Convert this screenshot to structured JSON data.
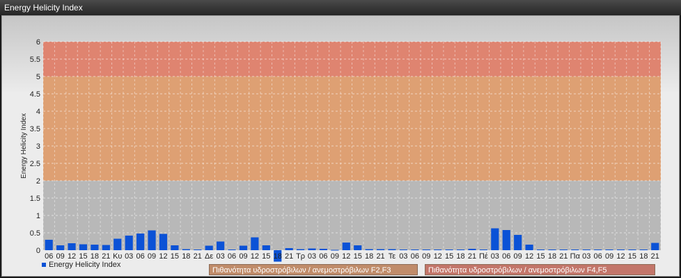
{
  "window": {
    "title": "Energy Helicity Index"
  },
  "legend": {
    "series_label": "Energy Helicity Index",
    "band_1_label": "Πιθανότητα υδροστρόβιλων / ανεμοστρόβιλων F2,F3",
    "band_2_label": "Πιθανότητα υδροστρόβιλων / ανεμοστρόβιλων F4,F5"
  },
  "colors": {
    "bar": "#0b52d6",
    "band_low": "#b8b8b8",
    "band_mid": "#dea073",
    "band_high": "#df8470",
    "band_1_legend": "#c08c6a",
    "band_2_legend": "#c3766a"
  },
  "chart_data": {
    "type": "bar",
    "ylabel": "Energy Helicity Index",
    "ylim": [
      0,
      6
    ],
    "yticks": [
      "0",
      "0.5",
      "1",
      "1.5",
      "2",
      "2.5",
      "3",
      "3.5",
      "4",
      "4.5",
      "5",
      "5.5",
      "6"
    ],
    "grid": true,
    "bands": [
      {
        "from": 0,
        "to": 2,
        "label": ""
      },
      {
        "from": 2,
        "to": 5,
        "label": "Πιθανότητα υδροστρόβιλων / ανεμοστρόβιλων F2,F3"
      },
      {
        "from": 5,
        "to": 6,
        "label": "Πιθανότητα υδροστρόβιλων / ανεμοστρόβιλων F4,F5"
      }
    ],
    "categories": [
      "06",
      "09",
      "12",
      "15",
      "18",
      "21",
      "Κυ",
      "03",
      "06",
      "09",
      "12",
      "15",
      "18",
      "21",
      "Δε",
      "03",
      "06",
      "09",
      "12",
      "15",
      "18",
      "21",
      "Τρ",
      "03",
      "06",
      "09",
      "12",
      "15",
      "18",
      "21",
      "Τε",
      "03",
      "06",
      "09",
      "12",
      "15",
      "18",
      "21",
      "Πέ",
      "03",
      "06",
      "09",
      "12",
      "15",
      "18",
      "21",
      "Πα",
      "03",
      "06",
      "09",
      "12",
      "15",
      "18",
      "21"
    ],
    "series": [
      {
        "name": "Energy Helicity Index",
        "values": [
          0.3,
          0.14,
          0.2,
          0.17,
          0.16,
          0.15,
          0.33,
          0.42,
          0.48,
          0.57,
          0.47,
          0.14,
          0.03,
          0.02,
          0.13,
          0.25,
          0.02,
          0.13,
          0.37,
          0.14,
          -0.33,
          0.06,
          0.03,
          0.05,
          0.04,
          0.01,
          0.22,
          0.14,
          0.03,
          0.03,
          0.03,
          0.02,
          0.02,
          0.02,
          0.02,
          0.02,
          0.02,
          0.04,
          0.02,
          0.63,
          0.58,
          0.44,
          0.16,
          0.02,
          0.02,
          0.02,
          0.02,
          0.02,
          0.02,
          0.02,
          0.02,
          0.02,
          0.02,
          0.21
        ]
      }
    ]
  }
}
